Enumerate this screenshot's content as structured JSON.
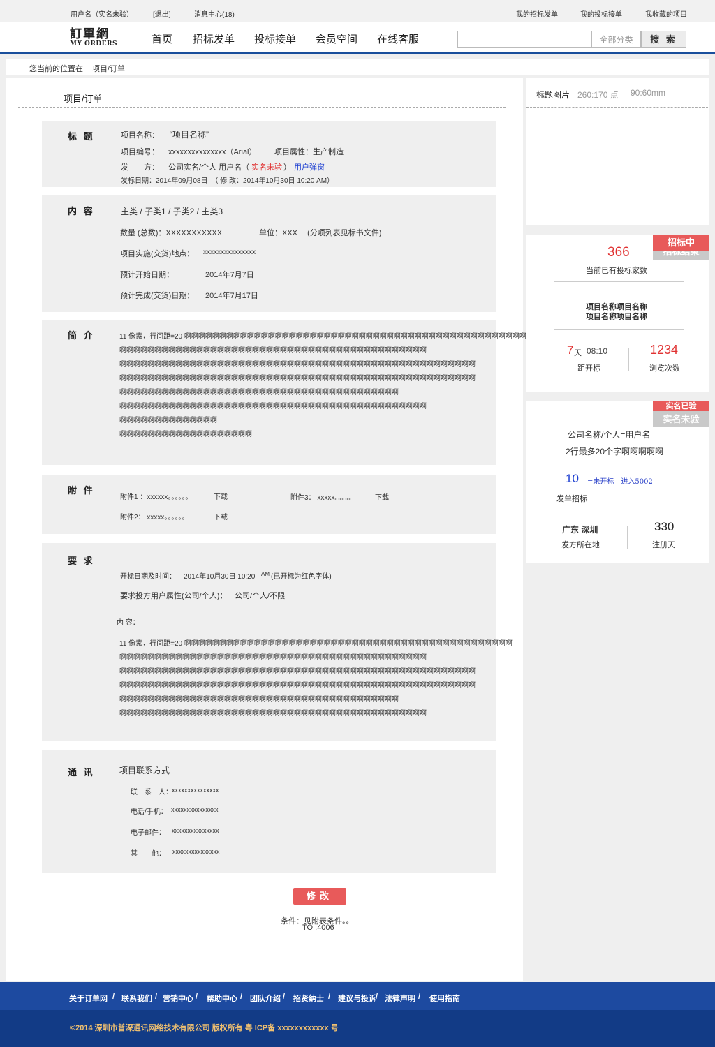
{
  "topbar": {
    "username": "用户名（实名未验）",
    "logout": "[退出]",
    "messages": "消息中心(18)",
    "my_tenders": "我的招标发单",
    "my_bids": "我的投标接单",
    "my_favorites": "我收藏的项目"
  },
  "logo": {
    "cn": "訂單網",
    "en": "MY ORDERS"
  },
  "nav": [
    "首页",
    "招标发单",
    "投标接单",
    "会员空间",
    "在线客服"
  ],
  "search": {
    "value": "",
    "category": "全部分类",
    "button": "搜 索"
  },
  "breadcrumb": {
    "label": "您当前的位置在",
    "current": "项目/订单"
  },
  "main": {
    "title": "项目/订单",
    "title_box": {
      "header": "标 题",
      "name_label": "项目名称：",
      "name_value": "“项目名称”",
      "no_label": "项目编号：",
      "no_value": "xxxxxxxxxxxxxxx（Arial）",
      "attr": "项目属性：生产制造",
      "issuer_label": "发　　方：",
      "issuer_value": "公司实名/个人 用户名（",
      "issuer_status": "实名未验",
      "issuer_close": "）",
      "issuer_link": "用户弹窗",
      "dates": "发标日期：2014年09月08日　（ 修 改：2014年10月30日 10:20  AM）"
    },
    "content_box": {
      "header": "内 容",
      "category": "主类 / 子类1 / 子类2 / 主类3",
      "quantity": "数量 (总数)：XXXXXXXXXXX",
      "unit": "单位：XXX　 (分项列表见标书文件)",
      "place_label": "项目实施(交货)地点：",
      "place_value": "xxxxxxxxxxxxxxx",
      "start_label": "预计开始日期：",
      "start_value": "2014年7月7日",
      "end_label": "预计完成(交货)日期：",
      "end_value": "2014年7月17日"
    },
    "intro_box": {
      "header": "简 介",
      "lines": [
        "11 像素，行间距=20 啊啊啊啊啊啊啊啊啊啊啊啊啊啊啊啊啊啊啊啊啊啊啊啊啊啊啊啊啊啊啊啊啊啊啊啊啊啊啊啊啊啊啊啊啊啊啊啊啊啊啊。",
        "啊啊啊啊啊啊啊啊啊啊啊啊啊啊啊啊啊啊啊啊啊啊啊啊啊啊啊啊啊啊啊啊啊啊啊啊啊啊啊啊啊啊啊啊",
        "啊啊啊啊啊啊啊啊啊啊啊啊啊啊啊啊啊啊啊啊啊啊啊啊啊啊啊啊啊啊啊啊啊啊啊啊啊啊啊啊啊啊啊啊啊啊啊啊啊啊啊",
        "啊啊啊啊啊啊啊啊啊啊啊啊啊啊啊啊啊啊啊啊啊啊啊啊啊啊啊啊啊啊啊啊啊啊啊啊啊啊啊啊啊啊啊啊啊啊啊啊啊啊啊",
        "啊啊啊啊啊啊啊啊啊啊啊啊啊啊啊啊啊啊啊啊啊啊啊啊啊啊啊啊啊啊啊啊啊啊啊啊啊啊啊啊",
        "啊啊啊啊啊啊啊啊啊啊啊啊啊啊啊啊啊啊啊啊啊啊啊啊啊啊啊啊啊啊啊啊啊啊啊啊啊啊啊啊啊啊啊啊",
        "啊啊啊啊啊啊啊啊啊啊啊啊啊啊",
        "啊啊啊啊啊啊啊啊啊啊啊啊啊啊啊啊啊啊啊"
      ]
    },
    "attach_box": {
      "header": "附 件",
      "a1_label": "附件1 ：xxxxxx。。。。。。",
      "a1_link": "下载",
      "a2_label": "附件2： xxxxx。。。。。。",
      "a2_link": "下载",
      "a3_label": "附件3： xxxxx。。。。。",
      "a3_link": "下载"
    },
    "req_box": {
      "header": "要 求",
      "open_label": "开标日期及时间：",
      "open_value": "2014年10月30日 10:20",
      "open_am": "AM",
      "open_note": "(已开标为红色字体)",
      "attr_label": "要求投方用户属性(公司/个人)：",
      "attr_value": "公司/个人/不限",
      "content_label": "内 容：",
      "lines": [
        "11 像素，行间距=20 啊啊啊啊啊啊啊啊啊啊啊啊啊啊啊啊啊啊啊啊啊啊啊啊啊啊啊啊啊啊啊啊啊啊啊啊啊啊啊啊啊啊啊啊啊啊啊",
        "啊啊啊啊啊啊啊啊啊啊啊啊啊啊啊啊啊啊啊啊啊啊啊啊啊啊啊啊啊啊啊啊啊啊啊啊啊啊啊啊啊啊啊啊",
        "啊啊啊啊啊啊啊啊啊啊啊啊啊啊啊啊啊啊啊啊啊啊啊啊啊啊啊啊啊啊啊啊啊啊啊啊啊啊啊啊啊啊啊啊啊啊啊啊啊啊啊",
        "啊啊啊啊啊啊啊啊啊啊啊啊啊啊啊啊啊啊啊啊啊啊啊啊啊啊啊啊啊啊啊啊啊啊啊啊啊啊啊啊啊啊啊啊啊啊啊啊啊啊啊",
        "啊啊啊啊啊啊啊啊啊啊啊啊啊啊啊啊啊啊啊啊啊啊啊啊啊啊啊啊啊啊啊啊啊啊啊啊啊啊啊啊",
        "啊啊啊啊啊啊啊啊啊啊啊啊啊啊啊啊啊啊啊啊啊啊啊啊啊啊啊啊啊啊啊啊啊啊啊啊啊啊啊啊啊啊啊啊"
      ]
    },
    "contact_box": {
      "header": "通 讯",
      "title": "项目联系方式",
      "contact_label": "联　系　人：",
      "contact_value": "xxxxxxxxxxxxxxx",
      "phone_label": "电话/手机：",
      "phone_value": "xxxxxxxxxxxxxxx",
      "email_label": "电子邮件：",
      "email_value": "xxxxxxxxxxxxxxx",
      "other_label": "其　　他：",
      "other_value": "xxxxxxxxxxxxxxx"
    },
    "modify_button": "修改",
    "conditions": "条件：见附表条件。。",
    "to": "TO :4006"
  },
  "side": {
    "image_label": "标题图片",
    "image_size": "260:170 点",
    "image_size2": "90:60mm",
    "status_tab": "招标中",
    "status_tab_back": "招标结束",
    "bid_count": "366",
    "bid_count_label": "当前已有投标家数",
    "project_name_1": "项目名称项目名称",
    "project_name_2": "项目名称项目名称",
    "days": "7",
    "days_unit": "天",
    "time": "08:10",
    "to_open_label": "距开标",
    "views": "1234",
    "views_label": "浏览次数",
    "verify_tab": "实名未验",
    "verify_tab_back": "实名已验",
    "company": "公司名称/个人=用户名",
    "company_note": "2行最多20个字啊啊啊啊啊",
    "tender_count": "10",
    "tender_note": "=未开标　进入5002",
    "tender_label": "发单招标",
    "location": "广东 深圳",
    "location_label": "发方所在地",
    "reg_days": "330",
    "reg_days_label": "注册天"
  },
  "footer": {
    "links": [
      "关于订单网",
      "/",
      "联系我们",
      "/",
      "营销中心",
      "/",
      "帮助中心",
      "/",
      "团队介绍",
      "/",
      "招贤纳士",
      "/",
      "建议与投诉",
      "/",
      "法律声明",
      "/",
      "使用指南"
    ],
    "copyright": "©2014 深圳市普深通讯网络技术有限公司 版权所有 粤 ICP备 xxxxxxxxxxxx 号"
  },
  "colors": {
    "accent": "#1a4f9c",
    "red": "#e03131",
    "tab_red": "#e85a5a",
    "footer_blue": "#1d4aa0",
    "footer_dark": "#123b86"
  }
}
